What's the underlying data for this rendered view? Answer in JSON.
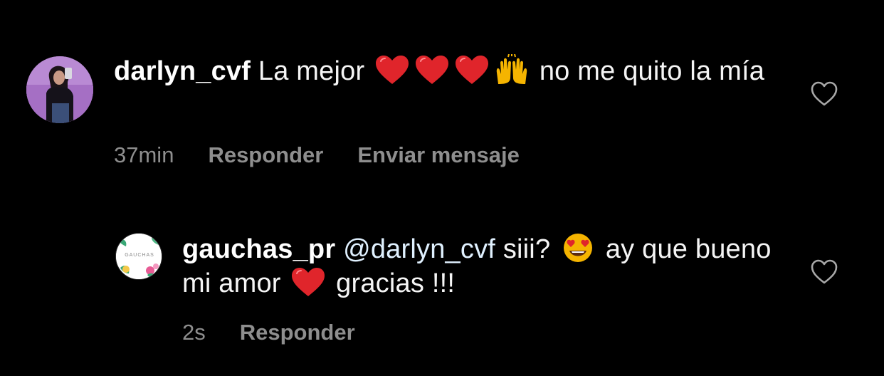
{
  "comments": [
    {
      "username": "darlyn_cvf",
      "text_before": "La mejor",
      "emojis": [
        "red-heart-emoji",
        "red-heart-emoji",
        "red-heart-emoji",
        "raising-hands-emoji"
      ],
      "text_after": "no me quito la mía",
      "time": "37min",
      "reply_label": "Responder",
      "message_label": "Enviar mensaje",
      "like_icon": "heart-outline-icon"
    },
    {
      "username": "gauchas_pr",
      "mention": "@darlyn_cvf",
      "text_before": "siii?",
      "emoji_1": "heart-eyes-emoji",
      "text_middle": "ay que bueno mi amor",
      "emoji_2": "red-heart-emoji",
      "text_after": "gracias !!!",
      "avatar_text": "GAUCHAS",
      "time": "2s",
      "reply_label": "Responder",
      "like_icon": "heart-outline-icon"
    }
  ],
  "colors": {
    "background": "#000000",
    "text": "#f5f5f5",
    "meta": "#8e8e8e",
    "heart": "#e0252b"
  }
}
